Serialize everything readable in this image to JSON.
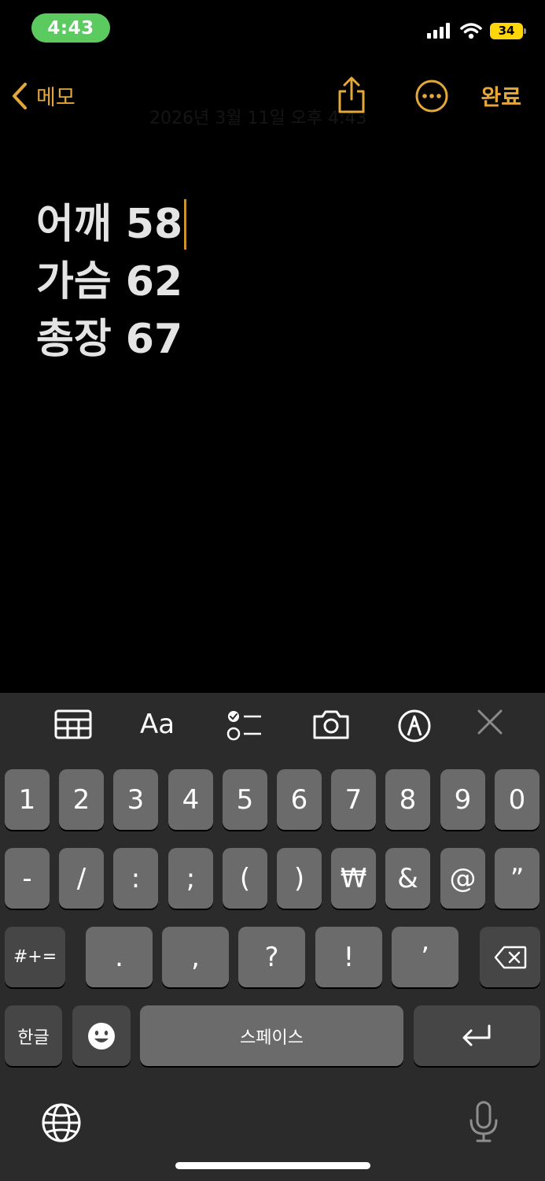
{
  "status": {
    "time": "4:43",
    "battery": "34"
  },
  "nav": {
    "back_label": "메모",
    "ghost_title": "2026년 3월 11일 오후 4:43",
    "done_label": "완료"
  },
  "note": {
    "lines": [
      "어깨 58",
      "가슴 62",
      "총장 67"
    ]
  },
  "format_bar": {
    "text_style_label": "Aa"
  },
  "keyboard": {
    "row1": [
      "1",
      "2",
      "3",
      "4",
      "5",
      "6",
      "7",
      "8",
      "9",
      "0"
    ],
    "row2": [
      "-",
      "/",
      ":",
      ";",
      "(",
      ")",
      "₩",
      "&",
      "@",
      "”"
    ],
    "row3_mode": "#+=",
    "row3": [
      ".",
      ",",
      "?",
      "!",
      "’"
    ],
    "row4_lang": "한글",
    "space_label": "스페이스"
  },
  "colors": {
    "accent": "#e3a73a",
    "battery": "#ffd60a",
    "time_pill": "#5ccb5f"
  }
}
